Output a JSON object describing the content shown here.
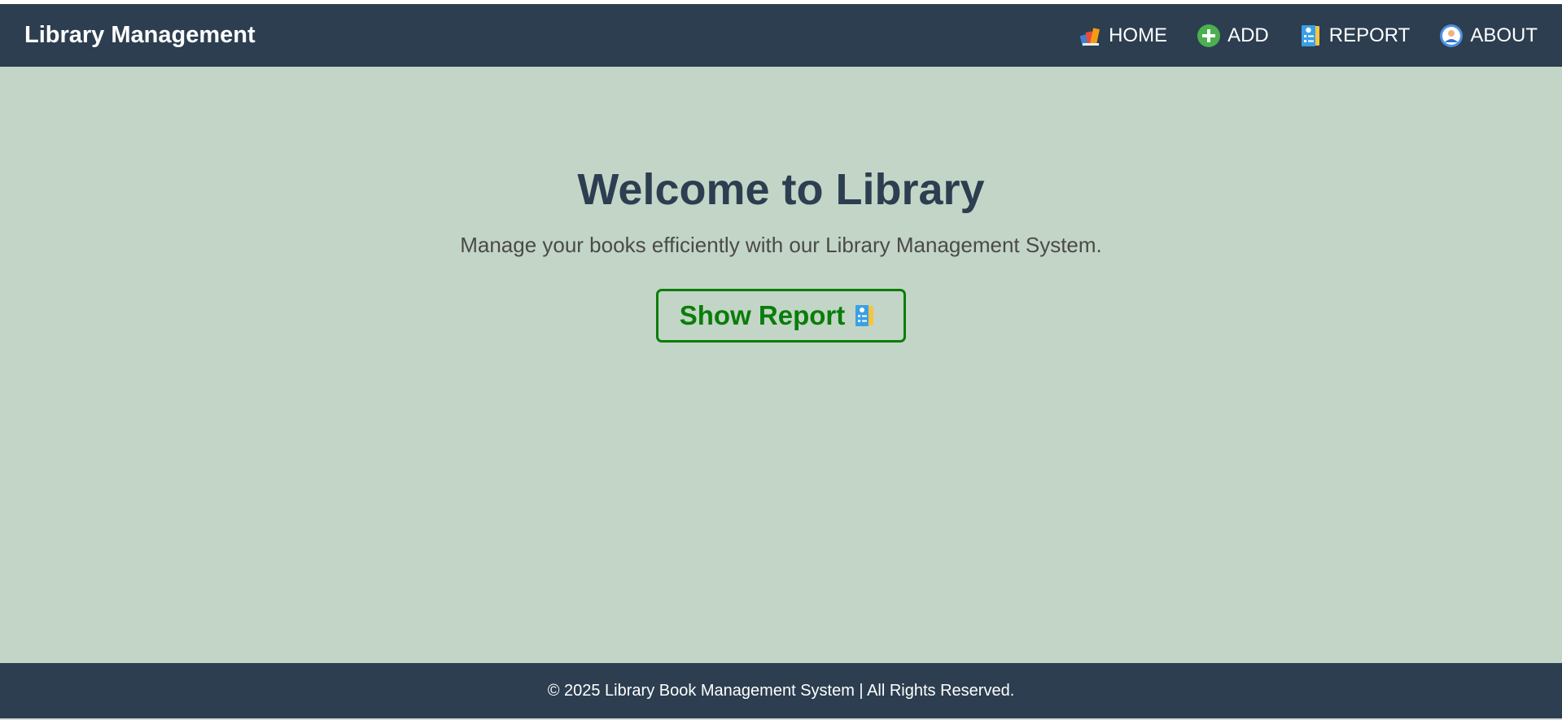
{
  "header": {
    "brand": "Library Management",
    "nav": [
      {
        "label": "HOME",
        "icon": "books-icon"
      },
      {
        "label": "ADD",
        "icon": "plus-circle-icon"
      },
      {
        "label": "REPORT",
        "icon": "report-icon"
      },
      {
        "label": "ABOUT",
        "icon": "user-circle-icon"
      }
    ]
  },
  "main": {
    "title": "Welcome to Library",
    "subtitle": "Manage your books efficiently with our Library Management System.",
    "button_label": "Show Report",
    "button_icon": "report-icon"
  },
  "footer": {
    "text": "© 2025 Library Book Management System | All Rights Reserved."
  },
  "colors": {
    "header_bg": "#2c3e50",
    "main_bg": "#c3d5c6",
    "title": "#2c3e50",
    "button_accent": "#0a7d0a",
    "add_icon": "#4caf50"
  }
}
